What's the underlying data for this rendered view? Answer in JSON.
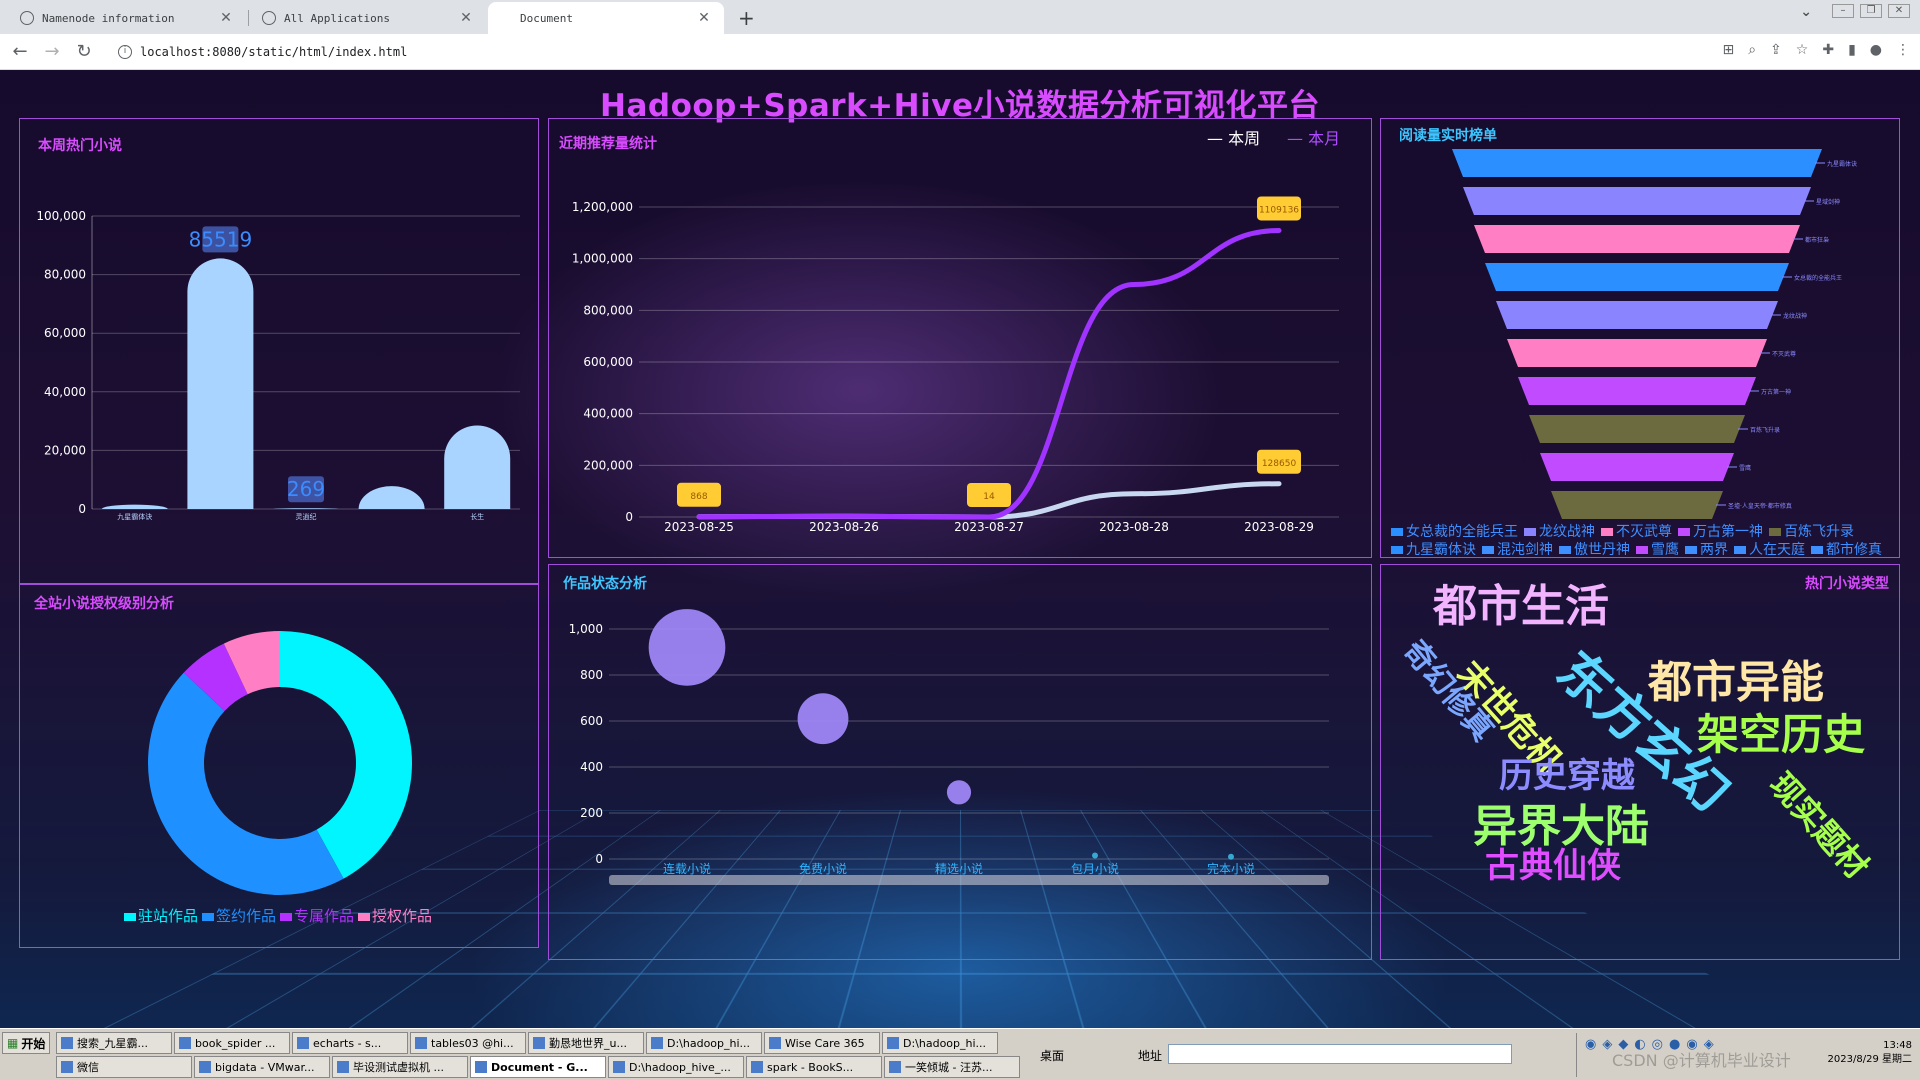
{
  "browser": {
    "tabs": [
      {
        "title": "Namenode information"
      },
      {
        "title": "All Applications"
      },
      {
        "title": "Document"
      }
    ],
    "url": "localhost:8080/static/html/index.html"
  },
  "dashboard": {
    "title": "Hadoop+Spark+Hive小说数据分析可视化平台",
    "colors": {
      "title": "#d94bff",
      "border": "#a24dd9",
      "accent_blue": "#1e90ff",
      "accent_cyan": "#00f5ff"
    }
  },
  "hot_novels_week": {
    "title": "本周热门小说",
    "chart_data": {
      "type": "bar",
      "categories": [
        "九星霸体诀",
        "",
        "灵逍纪",
        "",
        "长生"
      ],
      "values": [
        1500,
        85519,
        269,
        7800,
        28500
      ],
      "data_labels": [
        "",
        "85519",
        "269",
        "",
        ""
      ],
      "ylim": [
        0,
        100000
      ],
      "yticks": [
        "0",
        "20,000",
        "40,000",
        "60,000",
        "80,000",
        "100,000"
      ],
      "bar_color": "#a8d4ff"
    }
  },
  "recommend_stats": {
    "title": "近期推荐量统计",
    "legend": [
      "本周",
      "本月"
    ],
    "chart_data": {
      "type": "line",
      "x": [
        "2023-08-25",
        "2023-08-26",
        "2023-08-27",
        "2023-08-28",
        "2023-08-29"
      ],
      "ylim": [
        0,
        1200000
      ],
      "yticks": [
        "0",
        "200,000",
        "400,000",
        "600,000",
        "800,000",
        "1,000,000",
        "1,200,000"
      ],
      "series": [
        {
          "name": "本周",
          "values": [
            868,
            3000,
            14,
            90000,
            128650
          ],
          "color": "#c8d8f0"
        },
        {
          "name": "本月",
          "values": [
            868,
            3000,
            14,
            900000,
            1109136
          ],
          "color": "#a033ff"
        }
      ],
      "markers": [
        {
          "label": "868",
          "x": "2023-08-25",
          "y": 868
        },
        {
          "label": "14",
          "x": "2023-08-27",
          "y": 14
        },
        {
          "label": "1109136",
          "x": "2023-08-29",
          "y": 1109136
        },
        {
          "label": "128650",
          "x": "2023-08-29",
          "y": 128650
        }
      ]
    }
  },
  "reading_rank": {
    "title": "阅读量实时榜单",
    "chart_data": {
      "type": "funnel",
      "items": [
        {
          "name": "九星霸体诀",
          "color": "#2b8fff"
        },
        {
          "name": "星域剑神",
          "color": "#8a84ff"
        },
        {
          "name": "都市狂枭",
          "color": "#ff7ec4"
        },
        {
          "name": "女总裁的全能兵王",
          "color": "#2b8fff"
        },
        {
          "name": "龙纹战神",
          "color": "#8a84ff"
        },
        {
          "name": "不灭武尊",
          "color": "#ff7ec4"
        },
        {
          "name": "万古第一神",
          "color": "#c14cff"
        },
        {
          "name": "百炼飞升录",
          "color": "#6c6a3f"
        },
        {
          "name": "雪鹰",
          "color": "#c14cff"
        },
        {
          "name": "圣墟·人皇天帝·都市修真",
          "color": "#6c6a3f"
        }
      ]
    },
    "legend_row1": [
      "女总裁的全能兵王",
      "龙纹战神",
      "不灭武尊",
      "万古第一神",
      "百炼飞升录"
    ],
    "legend_row2": [
      "九星霸体诀",
      "混沌剑神",
      "傲世丹神",
      "雪鹰",
      "两界",
      "人在天庭",
      "都市修真"
    ]
  },
  "license_analysis": {
    "title": "全站小说授权级别分析",
    "chart_data": {
      "type": "pie",
      "slices": [
        {
          "name": "驻站作品",
          "value": 42,
          "color": "#00f5ff"
        },
        {
          "name": "签约作品",
          "value": 45,
          "color": "#1e90ff"
        },
        {
          "name": "专属作品",
          "value": 6,
          "color": "#b431ff"
        },
        {
          "name": "授权作品",
          "value": 7,
          "color": "#ff7ec4"
        }
      ]
    }
  },
  "work_status": {
    "title": "作品状态分析",
    "chart_data": {
      "type": "scatter",
      "categories": [
        "连载小说",
        "免费小说",
        "精选小说",
        "包月小说",
        "完本小说"
      ],
      "values": [
        920,
        610,
        290,
        15,
        10
      ],
      "ylim": [
        0,
        1000
      ],
      "yticks": [
        "0",
        "200",
        "400",
        "600",
        "800",
        "1,000"
      ]
    }
  },
  "hot_types": {
    "title": "热门小说类型",
    "words": [
      {
        "text": "都市生活",
        "color": "#f2b4ff"
      },
      {
        "text": "东方玄幻",
        "color": "#5ad6ff"
      },
      {
        "text": "都市异能",
        "color": "#ffe7a8"
      },
      {
        "text": "奇幻修真",
        "color": "#7ba7ff"
      },
      {
        "text": "末世危机",
        "color": "#e8ff6a"
      },
      {
        "text": "架空历史",
        "color": "#a6ff4a"
      },
      {
        "text": "现实题材",
        "color": "#a6ff4a"
      },
      {
        "text": "历史穿越",
        "color": "#8c8cff"
      },
      {
        "text": "异界大陆",
        "color": "#9dff6e"
      },
      {
        "text": "古典仙侠",
        "color": "#e04cff"
      }
    ]
  },
  "taskbar": {
    "start": "开始",
    "row1": [
      "搜索_九星霸...",
      "book_spider ...",
      "echarts - s...",
      "tables03 @hi...",
      "勤恳地世界_u...",
      "D:\\hadoop_hi...",
      "Wise Care 365",
      "D:\\hadoop_hi..."
    ],
    "row2": [
      "微信",
      "bigdata - VMwar...",
      "毕设测试虚拟机 ...",
      "Document - G...",
      "D:\\hadoop_hive_...",
      "spark - BookS...",
      "一笑倾城 - 汪苏..."
    ],
    "desktop": "桌面",
    "address": "地址",
    "time": "13:48",
    "date": "2023/8/29 星期二",
    "watermark": "CSDN @计算机毕业设计"
  }
}
